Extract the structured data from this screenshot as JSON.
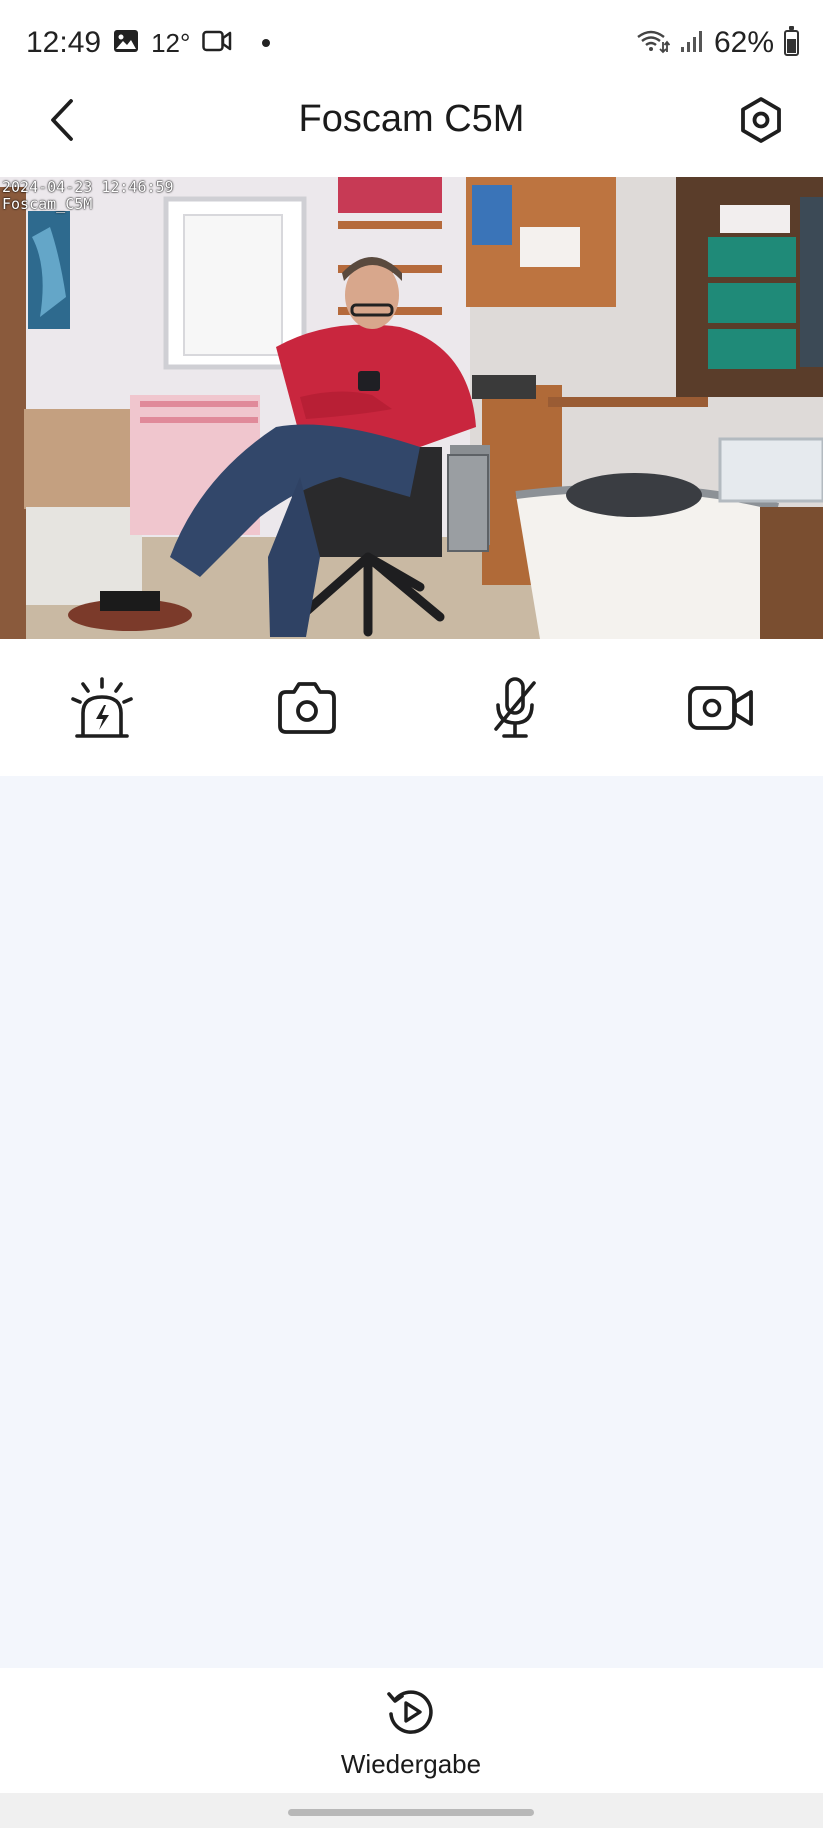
{
  "status_bar": {
    "time": "12:49",
    "temperature": "12°",
    "battery": "62%",
    "battery_level": 0.62,
    "icons": [
      "gallery-icon",
      "video-camera-icon",
      "wifi-icon",
      "signal-icon",
      "battery-icon"
    ]
  },
  "header": {
    "title": "Foscam C5M",
    "back_icon": "chevron-left-icon",
    "settings_icon": "hexagon-settings-icon"
  },
  "camera": {
    "timestamp": "2024-04-23 12:46:59",
    "camera_name": "Foscam_C5M"
  },
  "controls": [
    {
      "name": "siren",
      "icon": "siren-icon"
    },
    {
      "name": "snapshot",
      "icon": "camera-icon"
    },
    {
      "name": "microphone",
      "icon": "microphone-muted-icon"
    },
    {
      "name": "record",
      "icon": "video-record-icon"
    }
  ],
  "bottom": {
    "playback_label": "Wiedergabe",
    "playback_icon": "replay-icon"
  },
  "colors": {
    "background": "#ffffff",
    "content_background": "#f3f6fc",
    "text": "#1b1b1b",
    "icon": "#1e1e1e"
  }
}
